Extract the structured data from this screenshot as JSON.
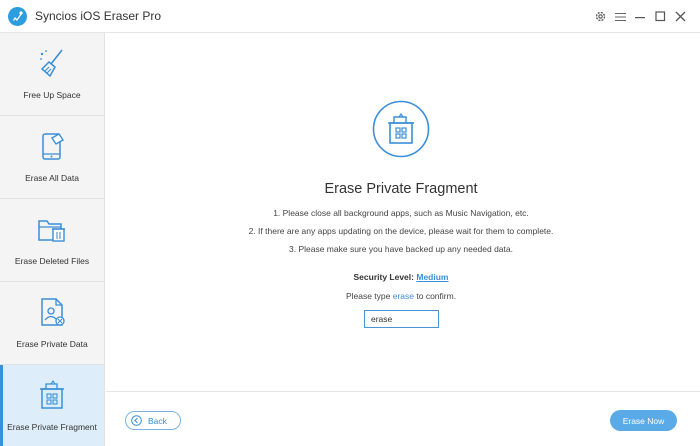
{
  "window": {
    "title": "Syncios iOS Eraser Pro",
    "controls": [
      "gear-icon",
      "menu-icon",
      "minimize-icon",
      "maximize-icon",
      "close-icon"
    ]
  },
  "sidebar": {
    "items": [
      {
        "label": "Free Up Space",
        "icon": "broom-icon",
        "active": false
      },
      {
        "label": "Erase All Data",
        "icon": "phone-erase-icon",
        "active": false
      },
      {
        "label": "Erase Deleted Files",
        "icon": "folder-trash-icon",
        "active": false
      },
      {
        "label": "Erase Private Data",
        "icon": "private-file-icon",
        "active": false
      },
      {
        "label": "Erase Private Fragment",
        "icon": "fragment-icon",
        "active": true
      }
    ]
  },
  "main": {
    "hero_icon": "fragment-icon",
    "heading": "Erase Private Fragment",
    "steps": [
      "1. Please close all background apps, such as Music Navigation, etc.",
      "2. If there are any apps updating on the device, please wait for them to complete.",
      "3. Please make sure you have backed up any needed data."
    ],
    "security": {
      "label": "Security Level:",
      "value": "Medium"
    },
    "confirm": {
      "prefix": "Please type",
      "keyword": "erase",
      "suffix": "to confirm."
    },
    "input_value": "erase"
  },
  "footer": {
    "back_label": "Back",
    "erase_now_label": "Erase Now"
  },
  "colors": {
    "accent": "#3a8fd8",
    "primary_button": "#5aaae8",
    "active_nav_bg": "#ddeefa",
    "sidebar_bg": "#f4f4f4"
  }
}
